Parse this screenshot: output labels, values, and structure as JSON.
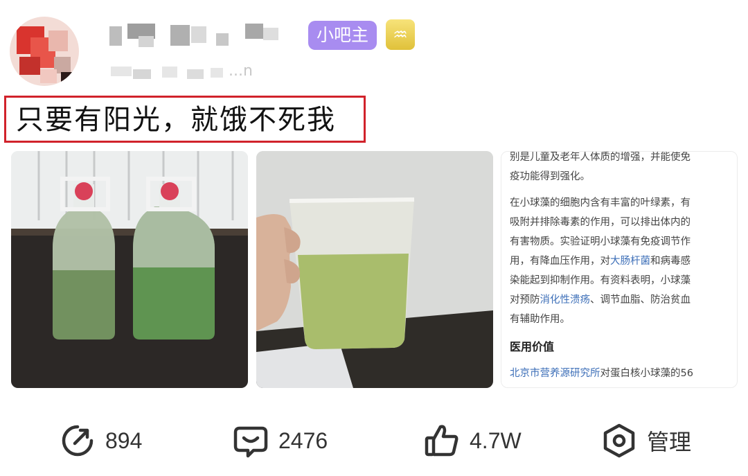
{
  "header": {
    "badge": "小吧主",
    "zodiac_symbol": "♒",
    "time_tail": "...n"
  },
  "post": {
    "title": "只要有阳光，就饿不死我"
  },
  "screenshot_text": {
    "lines": [
      {
        "text": "别是儿童及老年人体质的增强，并能使免",
        "style": "normal"
      },
      {
        "text": "疫功能得到强化。",
        "style": "normal"
      },
      {
        "text": "在小球藻的细胞内含有丰富的叶绿素，有",
        "style": "gap"
      },
      {
        "text": "吸附并排除毒素的作用，可以排出体内的",
        "style": "normal"
      },
      {
        "text": "有害物质。实验证明小球藻有免疫调节作",
        "style": "normal"
      },
      {
        "pre": "用，有降血压作用，对",
        "link": "大肠杆菌",
        "post": "和病毒感",
        "style": "normal"
      },
      {
        "text": "染能起到抑制作用。有资料表明，小球藻",
        "style": "normal"
      },
      {
        "pre": "对预防",
        "link": "消化性溃疡",
        "post": "、调节血脂、防治贫血",
        "style": "normal"
      },
      {
        "text": "有辅助作用。",
        "style": "normal"
      },
      {
        "text": "医用价值",
        "style": "bold"
      },
      {
        "pre": "",
        "link": "北京市营养源研究所",
        "post": "对蛋白核小球藻的56",
        "style": "gap"
      }
    ]
  },
  "actions": {
    "share_count": "894",
    "comment_count": "2476",
    "like_count": "4.7W",
    "manage_label": "管理"
  },
  "colors": {
    "badge": "#a88cf0",
    "title_border": "#d1222b",
    "link": "#3d6fb8"
  }
}
